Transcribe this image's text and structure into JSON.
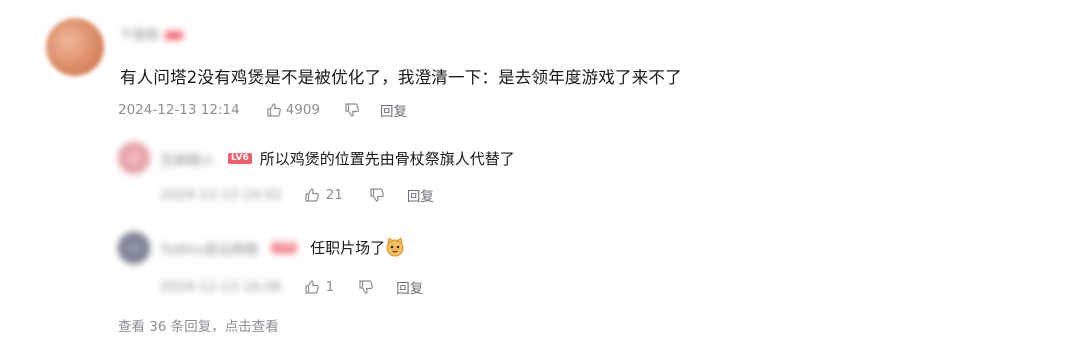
{
  "main_comment": {
    "user": "千瓶瓶",
    "text": "有人问塔2没有鸡煲是不是被优化了，我澄清一下：是去领年度游戏了来不了",
    "time": "2024-12-13 12:14",
    "likes": "4909",
    "reply_label": "回复"
  },
  "replies": [
    {
      "user": "芝麻糊小",
      "badge": "LV6",
      "text": "所以鸡煲的位置先由骨杖祭旗人代替了",
      "time": "2024-12-13 14:42",
      "likes": "21",
      "reply_label": "回复"
    },
    {
      "user": "ToWho是远阁楼",
      "badge": "LV6",
      "text": "任职片场了",
      "time": "2024-12-13 16:06",
      "likes": "1",
      "reply_label": "回复"
    }
  ],
  "view_more": "查看 36 条回复，点击查看",
  "icons": {
    "like": "thumbs-up-icon",
    "dislike": "thumbs-down-icon",
    "emoji": "cat-face-emoji-icon"
  }
}
